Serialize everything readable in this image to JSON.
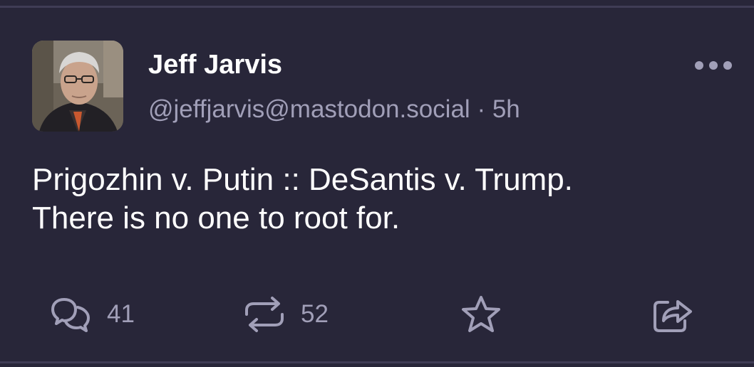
{
  "post": {
    "author": {
      "display_name": "Jeff Jarvis",
      "handle": "@jeffjarvis@mastodon.social",
      "separator": "·",
      "time": "5h"
    },
    "content": {
      "line1": "Prigozhin v. Putin :: DeSantis v. Trump.",
      "line2": "There is no one to root for."
    },
    "actions": {
      "reply_icon": "speech-bubbles-icon",
      "reply_count": "41",
      "boost_icon": "repeat-arrows-icon",
      "boost_count": "52",
      "favorite_icon": "star-icon",
      "share_icon": "share-arrow-icon"
    }
  },
  "colors": {
    "background": "#282639",
    "divider": "#3f3c55",
    "text_primary": "#ffffff",
    "text_secondary": "#a19fb8"
  }
}
